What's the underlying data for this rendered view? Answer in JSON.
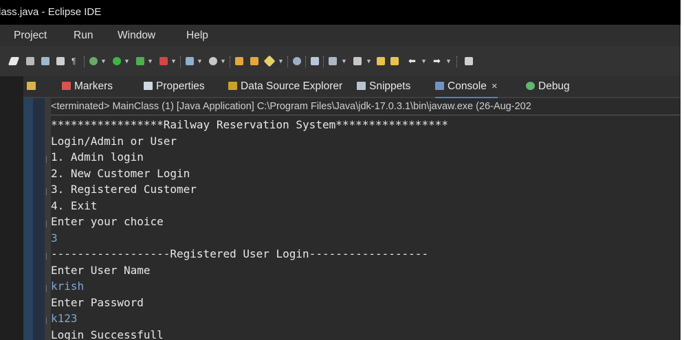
{
  "window": {
    "title": "lass.java - Eclipse IDE"
  },
  "menu": {
    "items": [
      "Project",
      "Run",
      "Window",
      "Help"
    ]
  },
  "tabs": {
    "markers": "Markers",
    "properties": "Properties",
    "data_source_explorer": "Data Source Explorer",
    "snippets": "Snippets",
    "console": "Console",
    "console_close": "×",
    "debug": "Debug"
  },
  "console": {
    "status": "<terminated> MainClass (1) [Java Application] C:\\Program Files\\Java\\jdk-17.0.3.1\\bin\\javaw.exe  (26-Aug-202",
    "lines": [
      {
        "text": "*****************Railway Reservation System*****************",
        "input": false
      },
      {
        "text": "Login/Admin or User",
        "input": false
      },
      {
        "text": "1. Admin login",
        "input": false
      },
      {
        "text": "2. New Customer Login",
        "input": false
      },
      {
        "text": "3. Registered Customer",
        "input": false
      },
      {
        "text": "4. Exit",
        "input": false
      },
      {
        "text": "Enter your choice",
        "input": false
      },
      {
        "text": "3",
        "input": true
      },
      {
        "text": "------------------Registered User Login------------------",
        "input": false
      },
      {
        "text": "Enter User Name",
        "input": false
      },
      {
        "text": "krish",
        "input": true
      },
      {
        "text": "Enter Password",
        "input": false
      },
      {
        "text": "k123",
        "input": true
      },
      {
        "text": "Login Successfull",
        "input": false
      }
    ]
  },
  "colors": {
    "console_input": "#7ea6d6",
    "active_tab_underline": "#3d86d8"
  }
}
